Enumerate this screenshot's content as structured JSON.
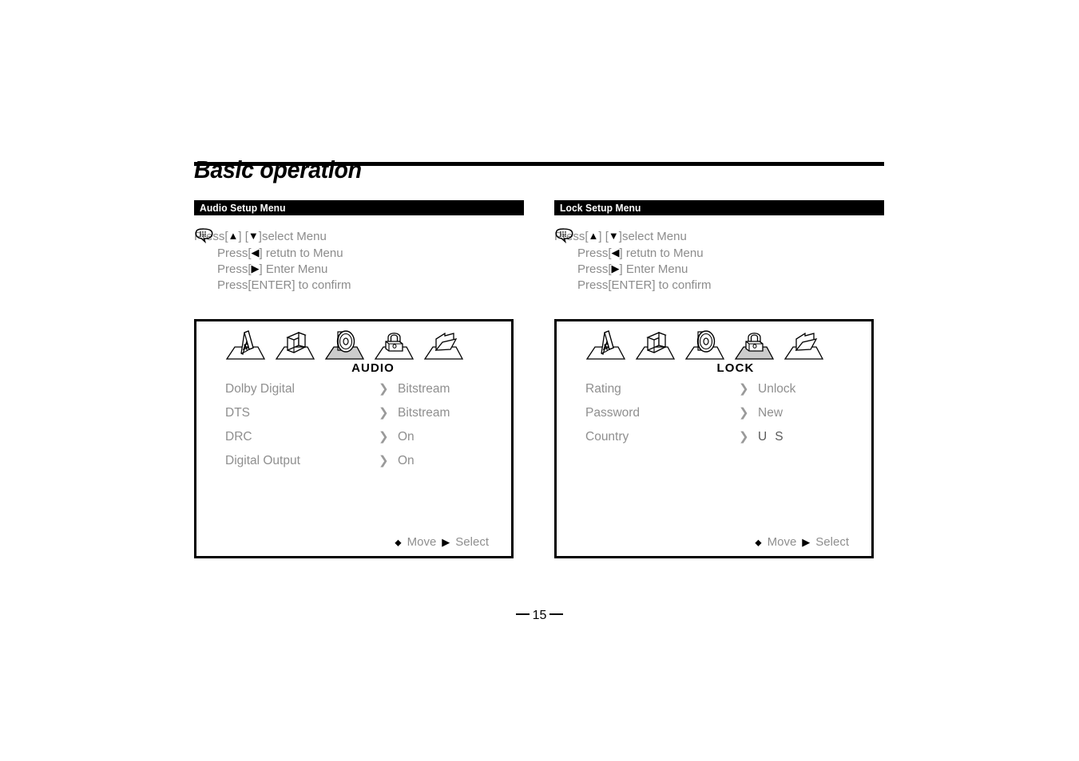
{
  "document": {
    "title": "Basic operation",
    "page_number": "15",
    "page_number_prefix": "—",
    "page_number_suffix": "—"
  },
  "colors": {
    "bar_background": "#000000",
    "bar_text": "#ffffff",
    "body_text": "#8c8c8c",
    "accent_black": "#000000",
    "icon_highlight": "#cccccc"
  },
  "instructions": {
    "icon": "speech-bubble-icon",
    "lines": [
      {
        "prefix": "Press[",
        "arrow": "▲",
        "mid": "] [",
        "arrow2": "▼",
        "suffix": "]select Menu"
      },
      {
        "prefix": "Press[",
        "arrow": "◀",
        "suffix": "] retutn to Menu"
      },
      {
        "prefix": "Press[",
        "arrow": "▶",
        "suffix": "] Enter Menu"
      },
      {
        "plain": "Press[ENTER] to confirm"
      }
    ]
  },
  "panels": [
    {
      "id": "audio",
      "header": "Audio Setup Menu",
      "mode_label": "AUDIO",
      "selected_icon_index": 2,
      "icons": [
        {
          "name": "language-letter-a-icon",
          "label": "LANGUAGE"
        },
        {
          "name": "video-box-icon",
          "label": "VIDEO"
        },
        {
          "name": "audio-disc-icon",
          "label": "AUDIO"
        },
        {
          "name": "lock-padlock-icon",
          "label": "LOCK"
        },
        {
          "name": "others-folder-icon",
          "label": "OTHERS"
        }
      ],
      "rows": [
        {
          "name": "Dolby Digital",
          "chevron": "❯",
          "value": "Bitstream"
        },
        {
          "name": "DTS",
          "chevron": "❯",
          "value": "Bitstream"
        },
        {
          "name": "DRC",
          "chevron": "❯",
          "value": "On"
        },
        {
          "name": "Digital Output",
          "chevron": "❯",
          "value": "On"
        }
      ],
      "footer": {
        "move": "Move",
        "select": "Select"
      }
    },
    {
      "id": "lock",
      "header": "Lock Setup Menu",
      "mode_label": "LOCK",
      "selected_icon_index": 3,
      "icons": [
        {
          "name": "language-letter-a-icon",
          "label": "LANGUAGE"
        },
        {
          "name": "video-box-icon",
          "label": "VIDEO"
        },
        {
          "name": "audio-disc-icon",
          "label": "AUDIO"
        },
        {
          "name": "lock-padlock-icon",
          "label": "LOCK"
        },
        {
          "name": "others-folder-icon",
          "label": "OTHERS"
        }
      ],
      "rows": [
        {
          "name": "Rating",
          "chevron": "❯",
          "value": "Unlock"
        },
        {
          "name": "Password",
          "chevron": "❯",
          "value": "New"
        },
        {
          "name": "Country",
          "chevron": "❯",
          "value_part1": "U",
          "value_part2": "S"
        }
      ],
      "footer": {
        "move": "Move",
        "select": "Select"
      }
    }
  ]
}
